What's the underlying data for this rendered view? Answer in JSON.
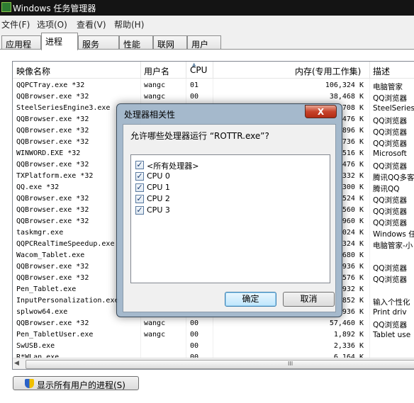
{
  "window": {
    "title": "Windows 任务管理器"
  },
  "menu": [
    "文件(F)",
    "选项(O)",
    "查看(V)",
    "帮助(H)"
  ],
  "tabs": [
    "应用程序",
    "进程",
    "服务",
    "性能",
    "联网",
    "用户"
  ],
  "active_tab": "进程",
  "columns": {
    "name": "映像名称",
    "user": "用户名",
    "cpu": "CPU",
    "mem": "内存(专用工作集)",
    "desc": "描述"
  },
  "rows": [
    {
      "name": "QQPCTray.exe *32",
      "user": "wangc",
      "cpu": "01",
      "mem": "106,324 K",
      "desc": "电脑管家"
    },
    {
      "name": "QQBrowser.exe *32",
      "user": "wangc",
      "cpu": "00",
      "mem": "38,468 K",
      "desc": "QQ浏览器"
    },
    {
      "name": "SteelSeriesEngine3.exe",
      "user": "",
      "cpu": "",
      "mem": "708 K",
      "desc": "SteelSeries"
    },
    {
      "name": "QQBrowser.exe *32",
      "user": "",
      "cpu": "",
      "mem": "476 K",
      "desc": "QQ浏览器"
    },
    {
      "name": "QQBrowser.exe *32",
      "user": "",
      "cpu": "",
      "mem": "896 K",
      "desc": "QQ浏览器"
    },
    {
      "name": "QQBrowser.exe *32",
      "user": "",
      "cpu": "",
      "mem": "736 K",
      "desc": "QQ浏览器"
    },
    {
      "name": "WINWORD.EXE *32",
      "user": "",
      "cpu": "",
      "mem": "516 K",
      "desc": "Microsoft"
    },
    {
      "name": "QQBrowser.exe *32",
      "user": "",
      "cpu": "",
      "mem": "476 K",
      "desc": "QQ浏览器"
    },
    {
      "name": "TXPlatform.exe *32",
      "user": "",
      "cpu": "",
      "mem": "332 K",
      "desc": "腾讯QQ多客"
    },
    {
      "name": "QQ.exe *32",
      "user": "",
      "cpu": "",
      "mem": "300 K",
      "desc": "腾讯QQ"
    },
    {
      "name": "QQBrowser.exe *32",
      "user": "",
      "cpu": "",
      "mem": "524 K",
      "desc": "QQ浏览器"
    },
    {
      "name": "QQBrowser.exe *32",
      "user": "",
      "cpu": "",
      "mem": "560 K",
      "desc": "QQ浏览器"
    },
    {
      "name": "QQBrowser.exe *32",
      "user": "",
      "cpu": "",
      "mem": "960 K",
      "desc": "QQ浏览器"
    },
    {
      "name": "taskmgr.exe",
      "user": "",
      "cpu": "",
      "mem": "024 K",
      "desc": "Windows 任"
    },
    {
      "name": "QQPCRealTimeSpeedup.exe",
      "user": "",
      "cpu": "",
      "mem": "324 K",
      "desc": "电脑管家-小"
    },
    {
      "name": "Wacom_Tablet.exe",
      "user": "",
      "cpu": "",
      "mem": "680 K",
      "desc": ""
    },
    {
      "name": "QQBrowser.exe *32",
      "user": "",
      "cpu": "",
      "mem": "936 K",
      "desc": "QQ浏览器"
    },
    {
      "name": "QQBrowser.exe *32",
      "user": "",
      "cpu": "",
      "mem": "576 K",
      "desc": "QQ浏览器"
    },
    {
      "name": "Pen_Tablet.exe",
      "user": "",
      "cpu": "",
      "mem": "932 K",
      "desc": ""
    },
    {
      "name": "InputPersonalization.exe",
      "user": "",
      "cpu": "",
      "mem": "852 K",
      "desc": "输入个性化"
    },
    {
      "name": "splwow64.exe",
      "user": "",
      "cpu": "",
      "mem": "936 K",
      "desc": "Print driv"
    },
    {
      "name": "QQBrowser.exe *32",
      "user": "wangc",
      "cpu": "00",
      "mem": "57,460 K",
      "desc": "QQ浏览器"
    },
    {
      "name": "Pen_TabletUser.exe",
      "user": "wangc",
      "cpu": "00",
      "mem": "1,892 K",
      "desc": "Tablet use"
    },
    {
      "name": "SwUSB.exe",
      "user": "",
      "cpu": "00",
      "mem": "2,336 K",
      "desc": ""
    },
    {
      "name": "R*WLan.exe",
      "user": "",
      "cpu": "00",
      "mem": "6,164 K",
      "desc": ""
    }
  ],
  "show_all_button": "显示所有用户的进程(S)",
  "dialog": {
    "title": "处理器相关性",
    "close": "X",
    "prompt": "允许哪些处理器运行 “ROTTR.exe”?",
    "items": [
      {
        "label": "<所有处理器>",
        "checked": true
      },
      {
        "label": "CPU 0",
        "checked": true
      },
      {
        "label": "CPU 1",
        "checked": true
      },
      {
        "label": "CPU 2",
        "checked": true
      },
      {
        "label": "CPU 3",
        "checked": true
      }
    ],
    "ok": "确定",
    "cancel": "取消"
  },
  "scroll_grip": "III"
}
